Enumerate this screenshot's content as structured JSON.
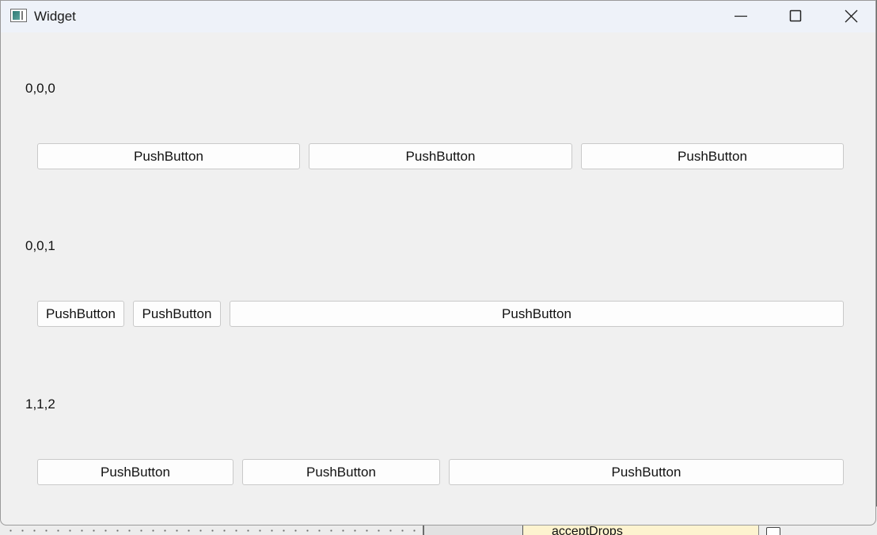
{
  "window": {
    "title": "Widget",
    "icon": "app-window-icon",
    "controls": {
      "minimize_icon": "minimize-icon",
      "maximize_icon": "maximize-icon",
      "close_icon": "close-icon"
    }
  },
  "groups": [
    {
      "label": "0,0,0",
      "buttons": [
        "PushButton",
        "PushButton",
        "PushButton"
      ]
    },
    {
      "label": "0,0,1",
      "buttons": [
        "PushButton",
        "PushButton",
        "PushButton"
      ]
    },
    {
      "label": "1,1,2",
      "buttons": [
        "PushButton",
        "PushButton",
        "PushButton"
      ]
    }
  ],
  "background_app": {
    "property_text": "acceptDrops"
  },
  "colors": {
    "window_bg": "#f0f0f0",
    "titlebar_bg": "#eef2f9",
    "button_bg": "#fdfdfd",
    "button_border": "#c9c9c9"
  }
}
